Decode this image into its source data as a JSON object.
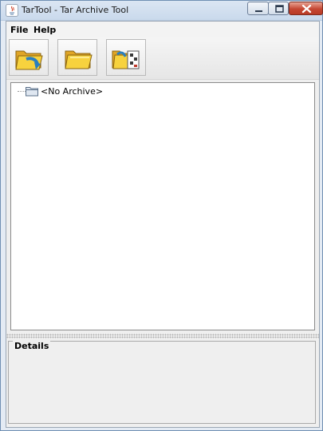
{
  "window": {
    "title": "TarTool - Tar Archive Tool"
  },
  "menu": {
    "items": [
      "File",
      "Help"
    ]
  },
  "toolbar": {
    "buttons": [
      {
        "icon": "open-archive-icon"
      },
      {
        "icon": "folder-icon"
      },
      {
        "icon": "view-files-icon"
      }
    ]
  },
  "tree": {
    "root_label": "<No Archive>"
  },
  "details": {
    "label": "Details"
  },
  "colors": {
    "title_bar": "#c9d9ec",
    "close_button": "#c54733",
    "panel_bg": "#efefef"
  }
}
